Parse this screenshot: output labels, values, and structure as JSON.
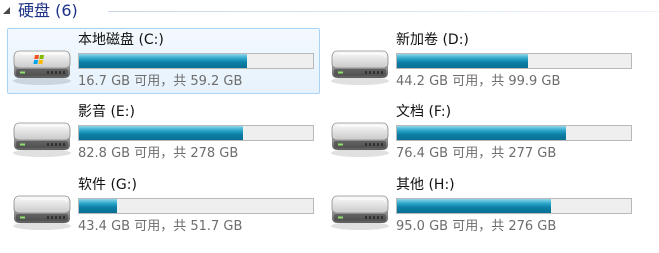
{
  "group": {
    "title": "硬盘 (6)"
  },
  "drives": [
    {
      "name": "本地磁盘 (C:)",
      "space": "16.7 GB 可用，共 59.2 GB",
      "used_fraction": 0.718,
      "selected": true,
      "os_drive": true
    },
    {
      "name": "新加卷 (D:)",
      "space": "44.2 GB 可用，共 99.9 GB",
      "used_fraction": 0.558,
      "selected": false,
      "os_drive": false
    },
    {
      "name": "影音 (E:)",
      "space": "82.8 GB 可用，共 278 GB",
      "used_fraction": 0.702,
      "selected": false,
      "os_drive": false
    },
    {
      "name": "文档 (F:)",
      "space": "76.4 GB 可用，共 277 GB",
      "used_fraction": 0.724,
      "selected": false,
      "os_drive": false
    },
    {
      "name": "软件 (G:)",
      "space": "43.4 GB 可用，共 51.7 GB",
      "used_fraction": 0.161,
      "selected": false,
      "os_drive": false
    },
    {
      "name": "其他 (H:)",
      "space": "95.0 GB 可用，共 276 GB",
      "used_fraction": 0.656,
      "selected": false,
      "os_drive": false
    }
  ],
  "colors": {
    "group_title": "#1e3287",
    "bar_fill": "#0d7fa6",
    "selection_border": "#a9d3f5"
  },
  "icons": {
    "drive": "hard-drive-icon",
    "os_badge": "windows-logo-icon",
    "collapse": "collapse-arrow-icon"
  }
}
